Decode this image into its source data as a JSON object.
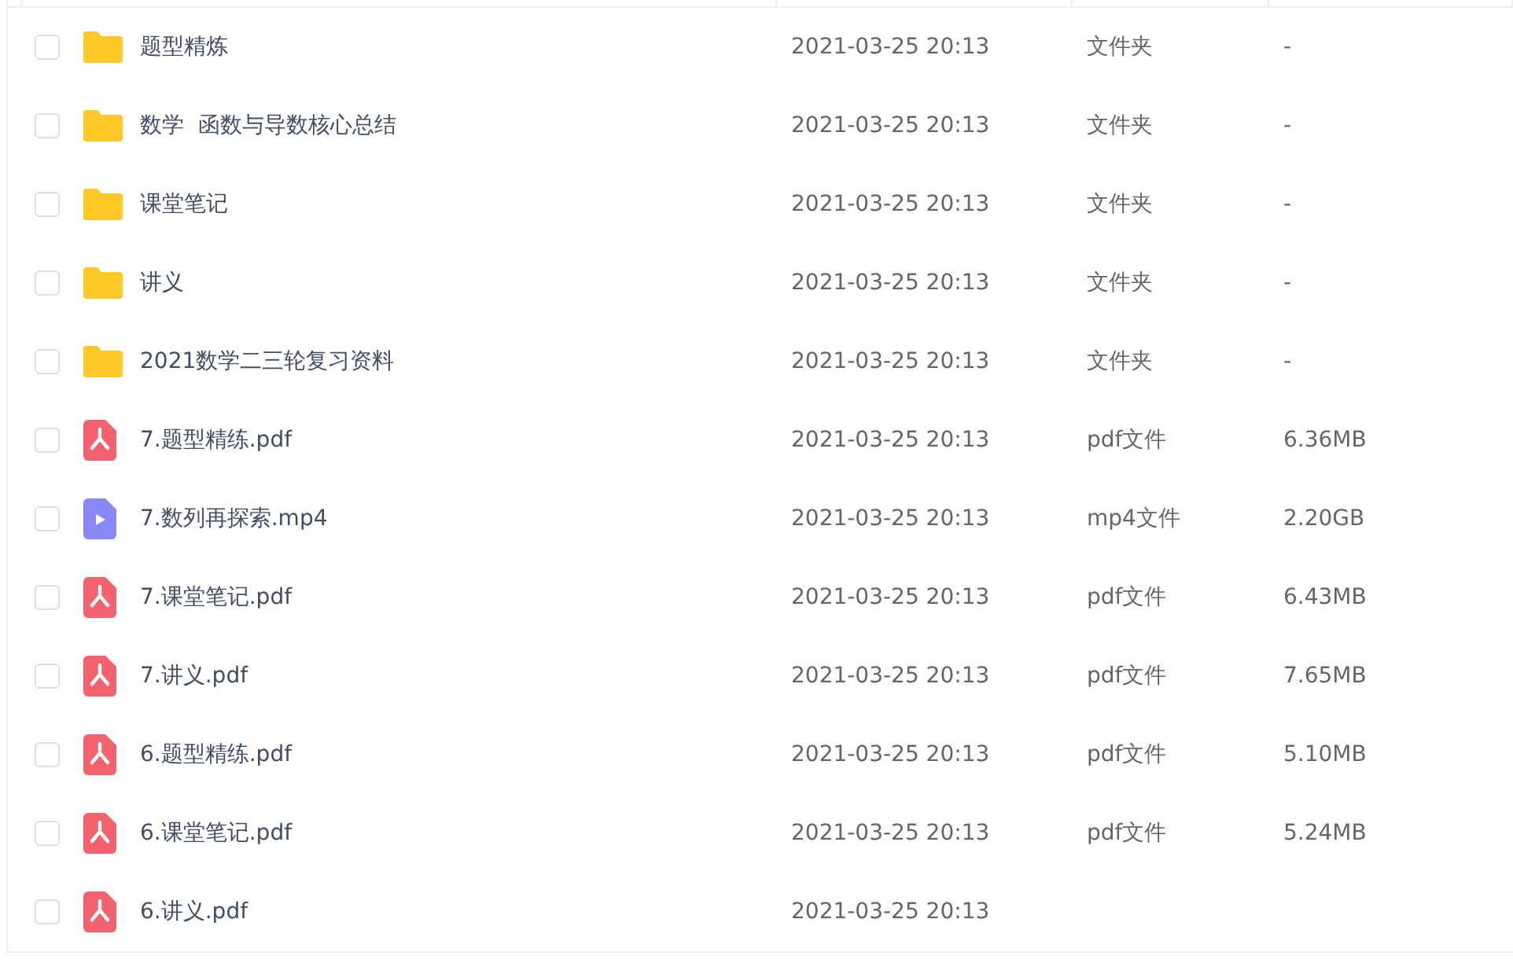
{
  "rows": [
    {
      "kind": "folder",
      "name": "题型精炼",
      "date": "2021-03-25 20:13",
      "type": "文件夹",
      "size": "-",
      "checked": false
    },
    {
      "kind": "folder",
      "name": "数学  函数与导数核心总结",
      "date": "2021-03-25 20:13",
      "type": "文件夹",
      "size": "-",
      "checked": false
    },
    {
      "kind": "folder",
      "name": "课堂笔记",
      "date": "2021-03-25 20:13",
      "type": "文件夹",
      "size": "-",
      "checked": false
    },
    {
      "kind": "folder",
      "name": "讲义",
      "date": "2021-03-25 20:13",
      "type": "文件夹",
      "size": "-",
      "checked": false
    },
    {
      "kind": "folder",
      "name": "2021数学二三轮复习资料",
      "date": "2021-03-25 20:13",
      "type": "文件夹",
      "size": "-",
      "checked": false
    },
    {
      "kind": "pdf",
      "name": "7.题型精练.pdf",
      "date": "2021-03-25 20:13",
      "type": "pdf文件",
      "size": "6.36MB",
      "checked": false
    },
    {
      "kind": "video",
      "name": "7.数列再探索.mp4",
      "date": "2021-03-25 20:13",
      "type": "mp4文件",
      "size": "2.20GB",
      "checked": false
    },
    {
      "kind": "pdf",
      "name": "7.课堂笔记.pdf",
      "date": "2021-03-25 20:13",
      "type": "pdf文件",
      "size": "6.43MB",
      "checked": false
    },
    {
      "kind": "pdf",
      "name": "7.讲义.pdf",
      "date": "2021-03-25 20:13",
      "type": "pdf文件",
      "size": "7.65MB",
      "checked": false
    },
    {
      "kind": "pdf",
      "name": "6.题型精练.pdf",
      "date": "2021-03-25 20:13",
      "type": "pdf文件",
      "size": "5.10MB",
      "checked": false
    },
    {
      "kind": "pdf",
      "name": "6.课堂笔记.pdf",
      "date": "2021-03-25 20:13",
      "type": "pdf文件",
      "size": "5.24MB",
      "checked": false
    },
    {
      "kind": "pdf",
      "name": "6.讲义.pdf",
      "date": "2021-03-25 20:13",
      "checked": false
    }
  ]
}
